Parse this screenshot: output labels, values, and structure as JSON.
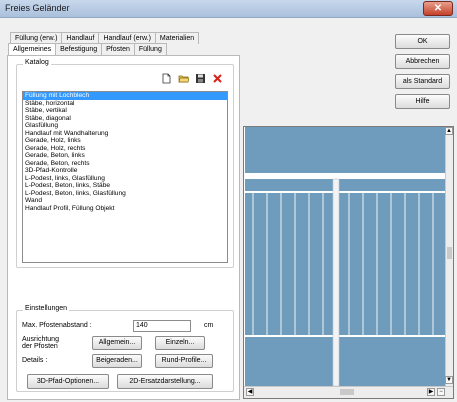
{
  "window": {
    "title": "Freies Geländer",
    "close_glyph": "✕"
  },
  "tabs": {
    "row1": [
      "Füllung (erw.)",
      "Handlauf",
      "Handlauf (erw.)",
      "Materialien"
    ],
    "row2": [
      "Allgemeines",
      "Befestigung",
      "Pfosten",
      "Füllung"
    ],
    "active": "Allgemeines"
  },
  "katalog": {
    "label": "Katalog",
    "toolbar_icons": [
      "new-file-icon",
      "open-folder-icon",
      "save-disk-icon",
      "delete-x-icon"
    ],
    "items": [
      "Füllung mit Lochblech",
      "Stäbe, horizontal",
      "Stäbe, vertikal",
      "Stäbe, diagonal",
      "Glasfüllung",
      "Handlauf mit Wandhalterung",
      "Gerade, Holz, links",
      "Gerade, Holz, rechts",
      "Gerade, Beton, links",
      "Gerade, Beton, rechts",
      "3D-Pfad-Kontrolle",
      "L-Podest, links, Glasfüllung",
      "L-Podest, Beton, links, Stäbe",
      "L-Podest, Beton, links, Glasfüllung",
      "Wand",
      "Handlauf Profil, Füllung Objekt"
    ],
    "selected_index": 0
  },
  "einstellungen": {
    "label": "Einstellungen",
    "max_abstand_label": "Max. Pfostenabstand :",
    "max_abstand_value": "140",
    "max_abstand_unit": "cm",
    "ausrichtung_label_1": "Ausrichtung",
    "ausrichtung_label_2": "der Pfosten",
    "btn_allgemein": "Allgemein...",
    "btn_einzeln": "Einzeln...",
    "details_label": "Details :",
    "btn_beigeraden": "Beigeraden...",
    "btn_rund_profile": "Rund-Profile...",
    "btn_3d_pfad": "3D-Pfad-Optionen...",
    "btn_2d_ersatz": "2D-Ersatzdarstellung..."
  },
  "right_buttons": {
    "ok": "OK",
    "abbrechen": "Abbrechen",
    "als_standard": "als Standard",
    "hilfe": "Hilfe"
  },
  "colors": {
    "preview_bg": "#6f9cbd",
    "rail": "#ffffff",
    "selection": "#3399ff"
  }
}
